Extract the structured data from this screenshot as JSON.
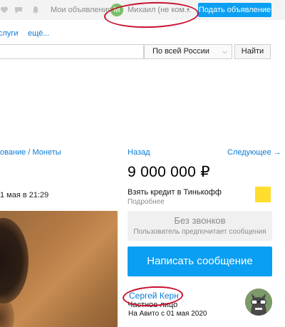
{
  "topbar": {
    "my_ads": "Мои объявления",
    "user_initial": "М",
    "user_name": "Михаил (не ком...",
    "post_ad": "Подать объявление"
  },
  "nav": {
    "services": "слуги",
    "more": "ещё..."
  },
  "search": {
    "query": "",
    "region": "По всей России",
    "find": "Найти"
  },
  "listing": {
    "breadcrumb": "ование / Монеты",
    "back": "Назад",
    "next": "Следующее →",
    "price": "9 000 000 ₽",
    "date": "1 мая в 21:29",
    "credit": "Взять кредит в Тинькофф",
    "credit_more": "Подробнее",
    "credit_logo": "Tinkoff.ru"
  },
  "contact": {
    "no_calls_title": "Без звонков",
    "no_calls_sub": "Пользователь предпочитает сообщения",
    "write_message": "Написать сообщение"
  },
  "seller": {
    "name": "Сергей Керн",
    "type": "Частное лицо",
    "since": "На Авито с 01 мая 2020"
  },
  "colors": {
    "accent": "#0a9ff2",
    "link": "#0a7bd6",
    "annotation": "#c8102e"
  }
}
